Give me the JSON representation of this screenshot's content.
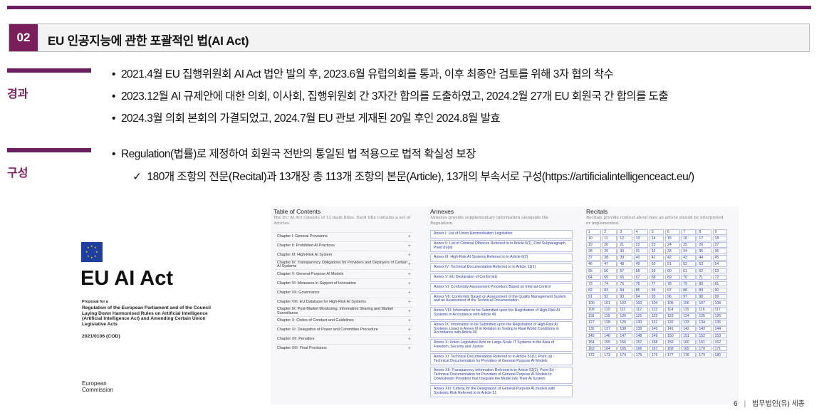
{
  "section": {
    "number": "02",
    "title": "EU 인공지능에 관한 포괄적인 법(AI Act)"
  },
  "history": {
    "label": "경과",
    "bullets": [
      "2021.4월 EU 집행위원회 AI Act 법안 발의 후, 2023.6월 유럽의회를 통과, 이후 최종안 검토를 위해 3자 협의 착수",
      "2023.12월 AI 규제안에 대한 의회, 이사회, 집행위원회 간 3자간 합의를 도출하였고, 2024.2월 27개 EU 회원국 간 합의를 도출",
      "2024.3월 의회 본회의 가결되었고, 2024.7월 EU  관보 게재된 20일 후인 2024.8월 발효"
    ]
  },
  "structure": {
    "label": "구성",
    "bullet": "Regulation(법률)로 제정하여 회원국 전반의 통일된 법 적용으로 법적 확실성 보장",
    "check": "180개 조항의 전문(Recital)과 13개장 총 113개 조항의 본문(Article), 13개의 부속서로 구성(https://artificialintelligenceact.eu/)"
  },
  "eu_logo": {
    "title": "EU AI Act",
    "proposal": "Proposal for a",
    "regulation": "Regulation of the European Parliament and of the Council Laying Down Harmonised Rules on Artificial Intelligence (Artificial Intelligence Act) and Amending Certain Union Legislative Acts",
    "code": "2021/0106 (COD)",
    "commission": "European Commission"
  },
  "toc": {
    "title": "Table of Contents",
    "desc": "The EU AI Act consists of 12 main titles. Each title contains a set of Articles.",
    "chapters": [
      "Chapter I: General Provisions",
      "Chapter II: Prohibited AI Practices",
      "Chapter III: High-Risk AI System",
      "Chapter IV: Transparency Obligations for Providers and Deployers of Certain AI Systems",
      "Chapter V: General-Purpose AI Models",
      "Chapter VI: Measures in Support of Innovation",
      "Chapter VII: Governance",
      "Chapter VIII: EU Database for High-Risk AI Systems",
      "Chapter IX: Post-Market Monitoring, Information Sharing and Market Surveillance",
      "Chapter X: Codes of Conduct and Guidelines",
      "Chapter XI: Delegation of Power and Committee Procedure",
      "Chapter XII: Penalties",
      "Chapter XIII: Final Provisions"
    ]
  },
  "annexes": {
    "title": "Annexes",
    "desc": "Annexes provide supplementary information alongside the Regulation.",
    "items": [
      "Annex I: List of Union Harmonisation Legislation",
      "Annex II: List of Criminal Offences Referred to in Article 5(1), First Subparagraph, Point (h)(iii)",
      "Annex III: High-Risk AI Systems Referred to in Article 6(2)",
      "Annex IV: Technical Documentation Referred to in Article 11(1)",
      "Annex V: EU Declaration of Conformity",
      "Annex VI: Conformity Assessment Procedure Based on Internal Control",
      "Annex VII: Conformity Based on Assessment of the Quality Management System and an Assessment of the Technical Documentation",
      "Annex VIII: Information to be Submitted upon the Registration of High-Risk AI Systems in Accordance with Article 49",
      "Annex IX: Information to be Submitted upon the Registration of High-Risk AI Systems Listed in Annex III in Relation to Testing in Real World Conditions in Accordance with Article 60",
      "Annex X: Union Legislative Acts on Large-Scale IT Systems in the Area of Freedom, Security and Justice",
      "Annex XI: Technical Documentation Referred to in Article 53(1), Point (a) - Technical Documentation for Providers of General-Purpose AI Models",
      "Annex XII: Transparency Information Referred to in Article 53(1), Point (b) - Technical Documentation for Providers of General-Purpose AI Models to Downstream Providers that Integrate the Model into Their AI System",
      "Annex XIII: Criteria for the Designation of General-Purpose AI models with Systemic Risk Referred to in Article 51"
    ]
  },
  "recitals": {
    "title": "Recitals",
    "desc": "Recitals provide context about how an article should be interpreted or implemented.",
    "count": 180
  },
  "footer": {
    "page": "6",
    "firm": "법무법인(유) 세종"
  },
  "colors": {
    "accent": "#7b1f5c",
    "link": "#2a3c9a"
  }
}
